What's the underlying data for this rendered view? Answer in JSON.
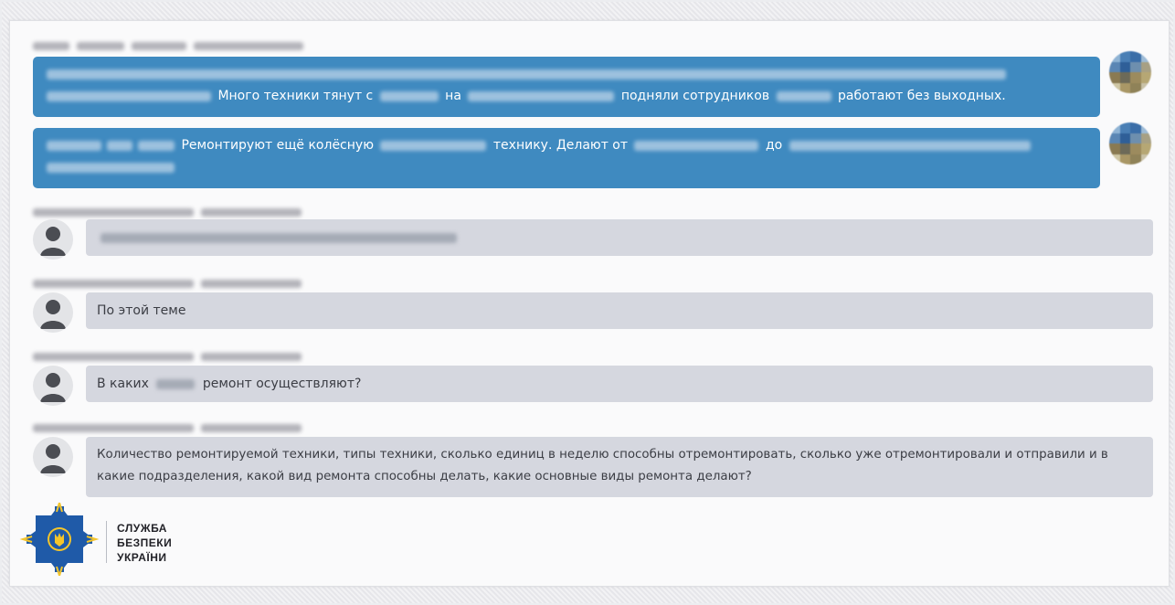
{
  "messages": [
    {
      "direction": "outgoing",
      "segments": [
        {
          "type": "text",
          "value": "Много техники тянут с"
        },
        {
          "type": "text",
          "value": "на"
        },
        {
          "type": "text",
          "value": "подняли сотрудников"
        },
        {
          "type": "text",
          "value": "работают без выходных."
        }
      ]
    },
    {
      "direction": "outgoing",
      "segments": [
        {
          "type": "text",
          "value": "Ремонтируют ещё колёсную"
        },
        {
          "type": "text",
          "value": "технику. Делают от"
        },
        {
          "type": "text",
          "value": "до"
        }
      ]
    },
    {
      "direction": "incoming",
      "text": ""
    },
    {
      "direction": "incoming",
      "text": "По этой теме"
    },
    {
      "direction": "incoming",
      "text_before": "В каких",
      "text_after": "ремонт осуществляют?"
    },
    {
      "direction": "incoming",
      "text": "Количество ремонтируемой техники, типы техники, сколько единиц в неделю способны отремонтировать, сколько уже отремонтировали и отправили и в какие подразделения, какой вид ремонта способны делать, какие основные виды ремонта делают?"
    }
  ],
  "icons": {
    "incoming_avatar": "person-silhouette-icon",
    "outgoing_avatar": "pixelated-avatar-icon",
    "logo": "ssu-emblem-icon"
  },
  "colors": {
    "outgoing_bubble": "#3f8ac0",
    "incoming_bubble": "#d5d7df",
    "logo_blue": "#1f5aa8",
    "logo_yellow": "#f4c52b"
  },
  "logo": {
    "line1": "СЛУЖБА",
    "line2": "БЕЗПЕКИ",
    "line3": "УКРАЇНИ"
  }
}
